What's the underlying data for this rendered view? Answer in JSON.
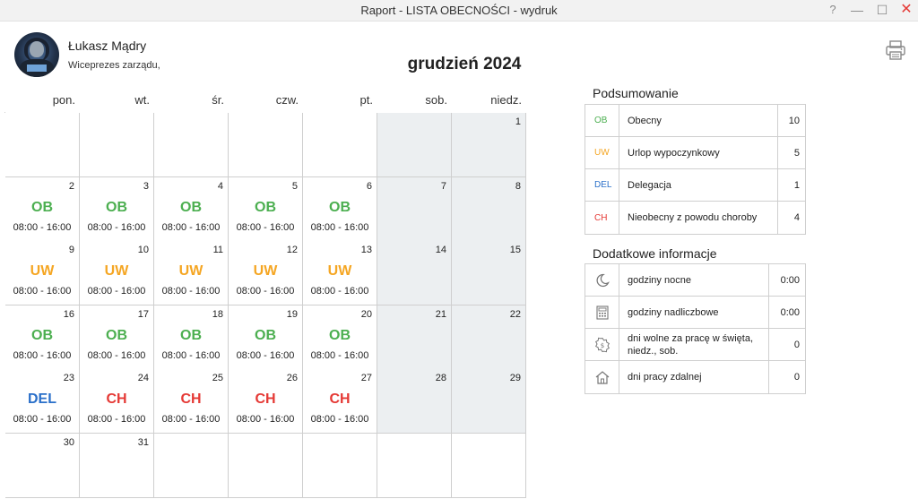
{
  "window": {
    "title": "Raport - LISTA OBECNOŚCI - wydruk",
    "help": "?",
    "minimize": "—",
    "maximize": "☐",
    "close": "✕"
  },
  "user": {
    "name": "Łukasz Mądry",
    "role": "Wiceprezes zarządu,"
  },
  "month_title": "grudzień 2024",
  "weekdays": [
    "pon.",
    "wt.",
    "śr.",
    "czw.",
    "pt.",
    "sob.",
    "niedz."
  ],
  "colors": {
    "OB": "#4caf50",
    "UW": "#f5a623",
    "DEL": "#2a6fc9",
    "CH": "#e53935",
    "weekend": "#eceff1"
  },
  "calendar": [
    [
      {
        "day": ""
      },
      {
        "day": ""
      },
      {
        "day": ""
      },
      {
        "day": ""
      },
      {
        "day": ""
      },
      {
        "day": "",
        "weekend": true
      },
      {
        "day": "1",
        "weekend": true
      }
    ],
    [
      {
        "day": "2",
        "code": "OB",
        "hours": "08:00 - 16:00"
      },
      {
        "day": "3",
        "code": "OB",
        "hours": "08:00 - 16:00"
      },
      {
        "day": "4",
        "code": "OB",
        "hours": "08:00 - 16:00"
      },
      {
        "day": "5",
        "code": "OB",
        "hours": "08:00 - 16:00"
      },
      {
        "day": "6",
        "code": "OB",
        "hours": "08:00 - 16:00"
      },
      {
        "day": "7",
        "weekend": true
      },
      {
        "day": "8",
        "weekend": true
      }
    ],
    [
      {
        "day": "9",
        "code": "UW",
        "hours": "08:00 - 16:00"
      },
      {
        "day": "10",
        "code": "UW",
        "hours": "08:00 - 16:00"
      },
      {
        "day": "11",
        "code": "UW",
        "hours": "08:00 - 16:00"
      },
      {
        "day": "12",
        "code": "UW",
        "hours": "08:00 - 16:00"
      },
      {
        "day": "13",
        "code": "UW",
        "hours": "08:00 - 16:00"
      },
      {
        "day": "14",
        "weekend": true
      },
      {
        "day": "15",
        "weekend": true
      }
    ],
    [
      {
        "day": "16",
        "code": "OB",
        "hours": "08:00 - 16:00"
      },
      {
        "day": "17",
        "code": "OB",
        "hours": "08:00 - 16:00"
      },
      {
        "day": "18",
        "code": "OB",
        "hours": "08:00 - 16:00"
      },
      {
        "day": "19",
        "code": "OB",
        "hours": "08:00 - 16:00"
      },
      {
        "day": "20",
        "code": "OB",
        "hours": "08:00 - 16:00"
      },
      {
        "day": "21",
        "weekend": true
      },
      {
        "day": "22",
        "weekend": true
      }
    ],
    [
      {
        "day": "23",
        "code": "DEL",
        "hours": "08:00 - 16:00"
      },
      {
        "day": "24",
        "code": "CH",
        "hours": "08:00 - 16:00"
      },
      {
        "day": "25",
        "code": "CH",
        "hours": "08:00 - 16:00"
      },
      {
        "day": "26",
        "code": "CH",
        "hours": "08:00 - 16:00"
      },
      {
        "day": "27",
        "code": "CH",
        "hours": "08:00 - 16:00"
      },
      {
        "day": "28",
        "weekend": true
      },
      {
        "day": "29",
        "weekend": true
      }
    ],
    [
      {
        "day": "30"
      },
      {
        "day": "31"
      },
      {
        "day": ""
      },
      {
        "day": ""
      },
      {
        "day": ""
      },
      {
        "day": ""
      },
      {
        "day": ""
      }
    ]
  ],
  "summary": {
    "title": "Podsumowanie",
    "rows": [
      {
        "code": "OB",
        "label": "Obecny",
        "value": "10"
      },
      {
        "code": "UW",
        "label": "Urlop wypoczynkowy",
        "value": "5"
      },
      {
        "code": "DEL",
        "label": "Delegacja",
        "value": "1"
      },
      {
        "code": "CH",
        "label": "Nieobecny z powodu choroby",
        "value": "4"
      }
    ]
  },
  "extra": {
    "title": "Dodatkowe informacje",
    "rows": [
      {
        "icon": "moon-icon",
        "label": "godziny nocne",
        "value": "0:00"
      },
      {
        "icon": "calculator-icon",
        "label": "godziny nadliczbowe",
        "value": "0:00"
      },
      {
        "icon": "holiday-gear-icon",
        "label": "dni wolne za pracę w święta, niedz., sob.",
        "value": "0"
      },
      {
        "icon": "home-icon",
        "label": "dni pracy zdalnej",
        "value": "0"
      }
    ]
  }
}
